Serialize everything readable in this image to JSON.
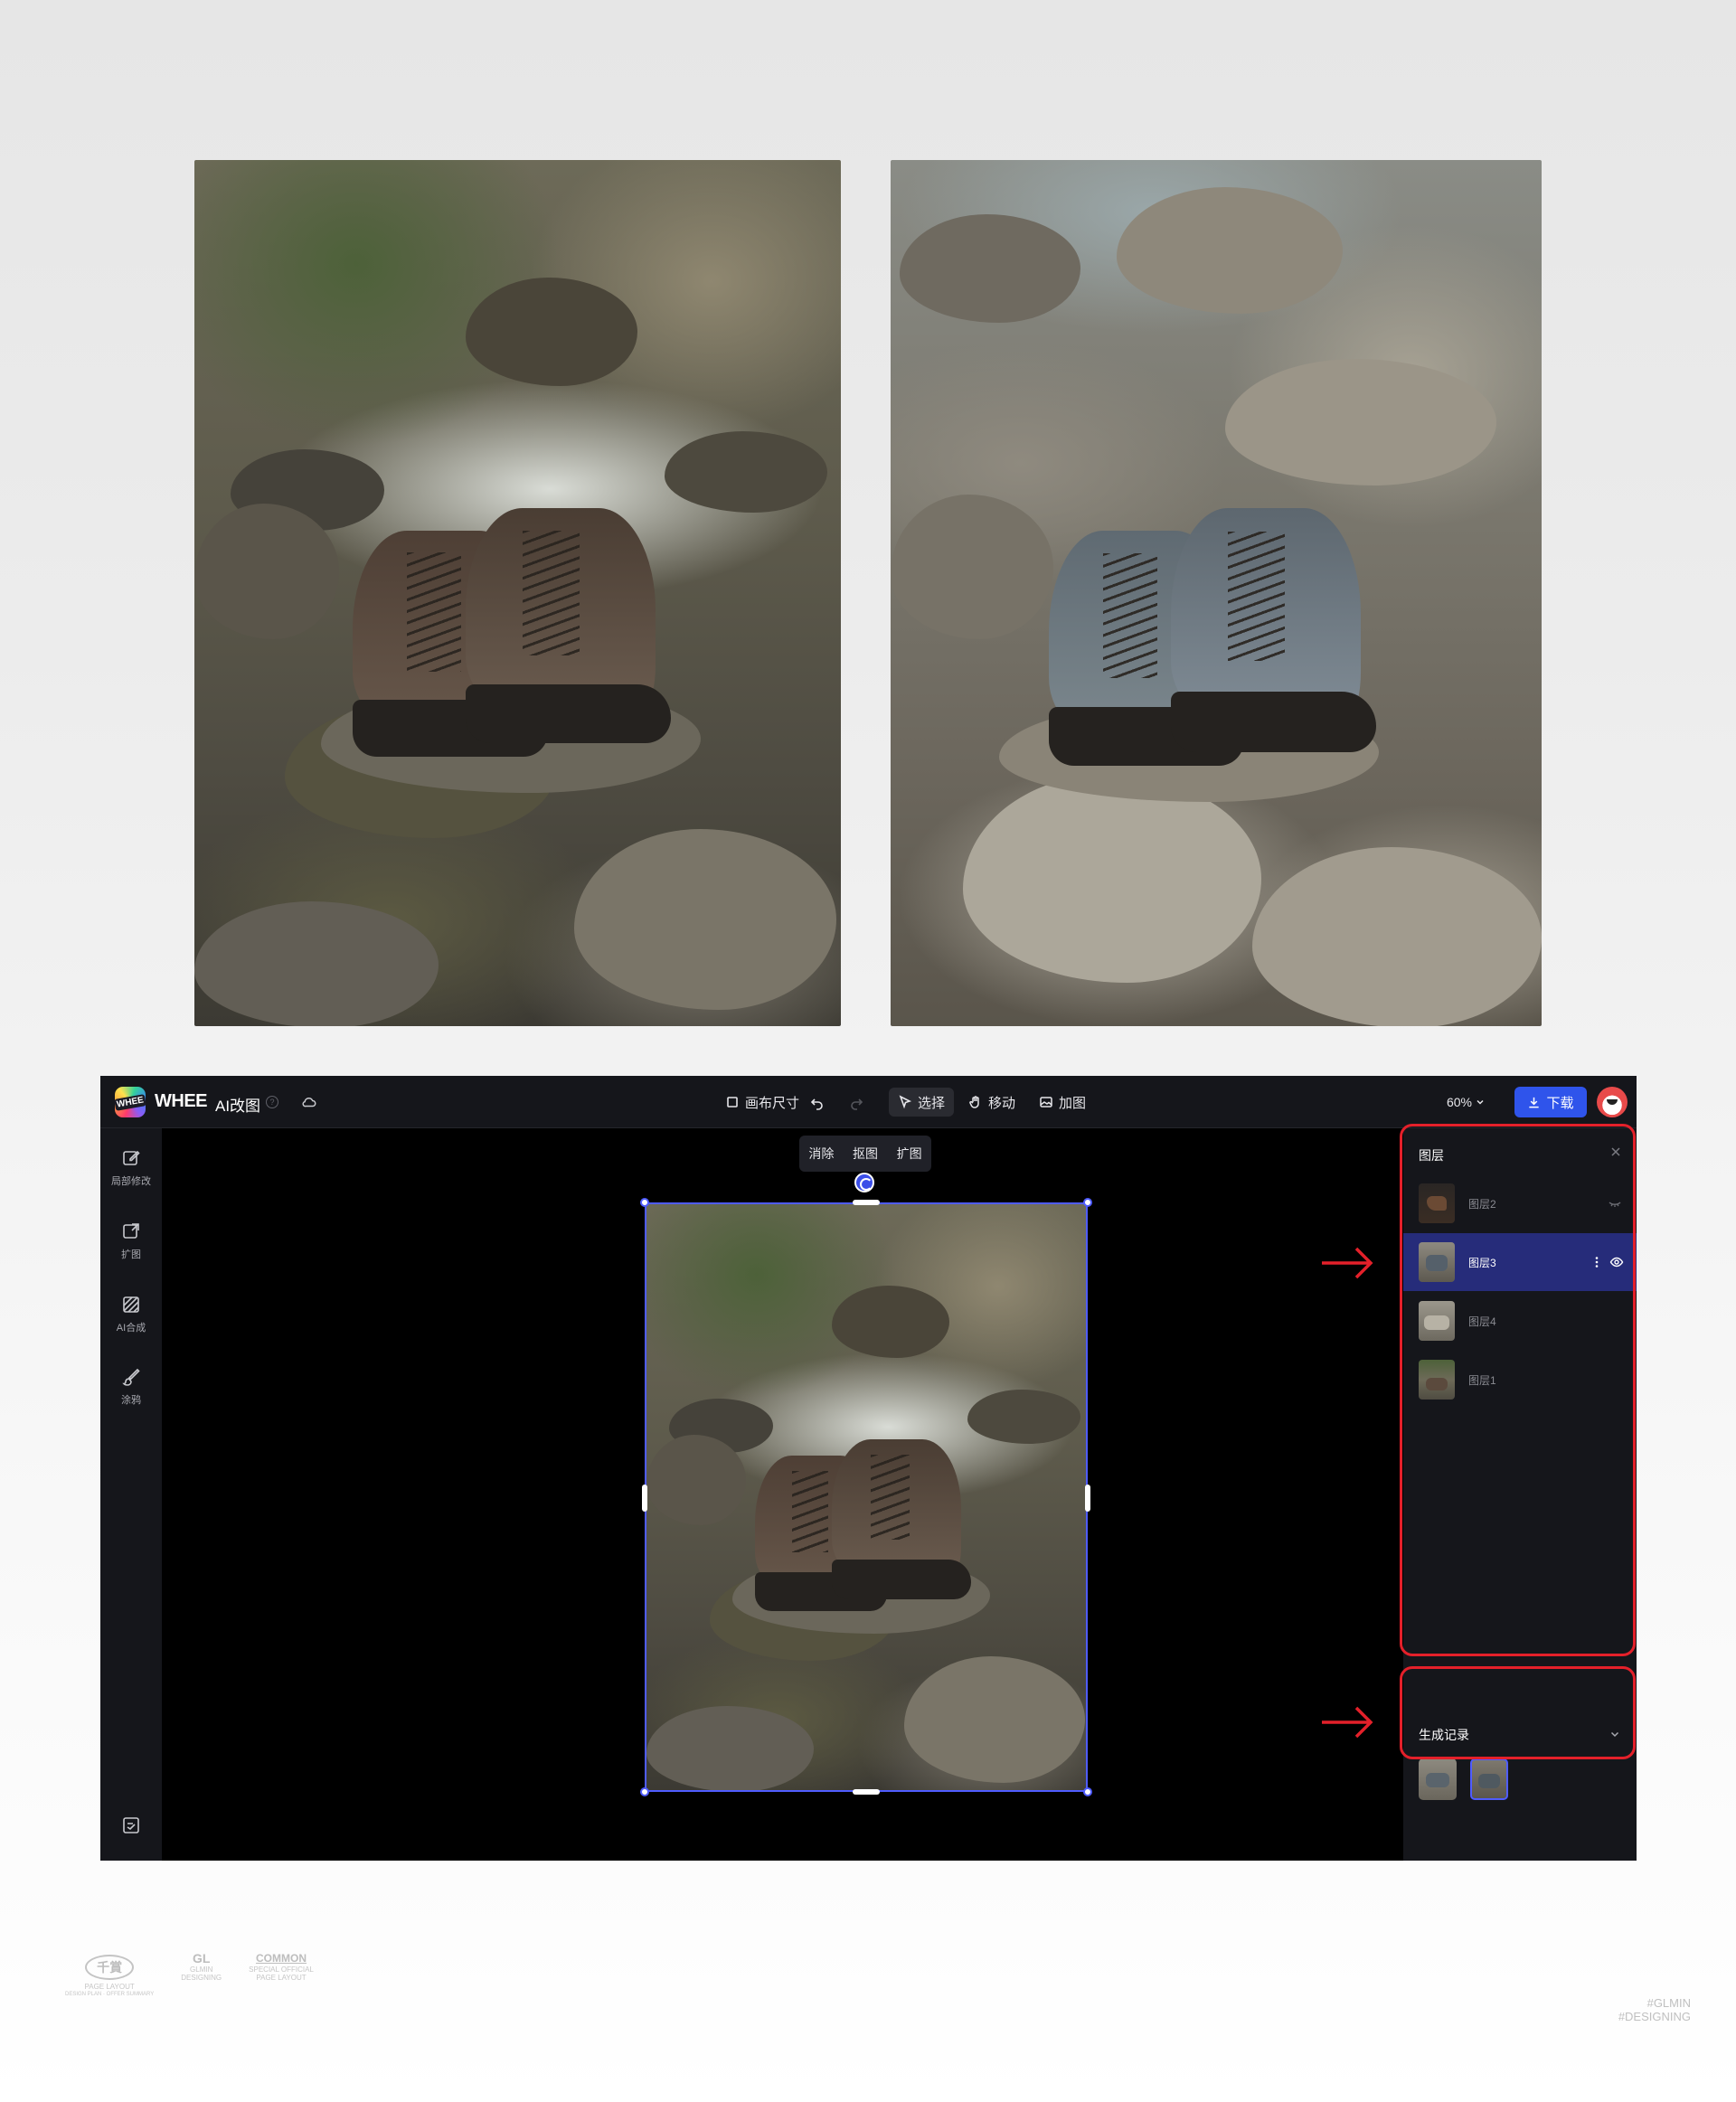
{
  "app": {
    "logo_text": "WHEE",
    "brand": "WHEE",
    "name": "AI改图",
    "help": "?"
  },
  "toolbar": {
    "canvas_size": "画布尺寸",
    "select": "选择",
    "move": "移动",
    "add_image": "加图",
    "zoom": "60%",
    "download": "下载"
  },
  "leftbar": {
    "items": [
      {
        "label": "局部修改",
        "icon": "edit-icon"
      },
      {
        "label": "扩图",
        "icon": "expand-icon"
      },
      {
        "label": "AI合成",
        "icon": "ai-compose-icon"
      },
      {
        "label": "涂鸦",
        "icon": "brush-icon"
      }
    ]
  },
  "canvas_toolbar": {
    "erase": "消除",
    "cutout": "抠图",
    "expand": "扩图"
  },
  "layers_panel": {
    "title": "图层",
    "layers": [
      {
        "name": "图层2",
        "selected": false,
        "visible": false
      },
      {
        "name": "图层3",
        "selected": true,
        "visible": true
      },
      {
        "name": "图层4",
        "selected": false,
        "visible": true
      },
      {
        "name": "图层1",
        "selected": false,
        "visible": true
      }
    ]
  },
  "generation_history": {
    "title": "生成记录",
    "count": 2
  },
  "footer": {
    "logo1_mark": "千賞",
    "logo1_text": "PAGE LAYOUT",
    "logo1_sub": "DESIGN PLAN · OFFER SUMMARY",
    "logo2_mark": "GL",
    "logo2_text": "GLMIN",
    "logo2_sub": "DESIGNING",
    "logo3_mark": "COMMON",
    "logo3_text": "SPECIAL OFFICIAL",
    "logo3_sub": "PAGE LAYOUT",
    "tag1": "#GLMIN",
    "tag2": "#DESIGNING"
  },
  "colors": {
    "accent": "#2f54eb",
    "selection": "#4f5cff",
    "selected_layer_bg": "#262c7a",
    "highlight_red": "#e4202a",
    "panel_bg": "#15161b"
  }
}
